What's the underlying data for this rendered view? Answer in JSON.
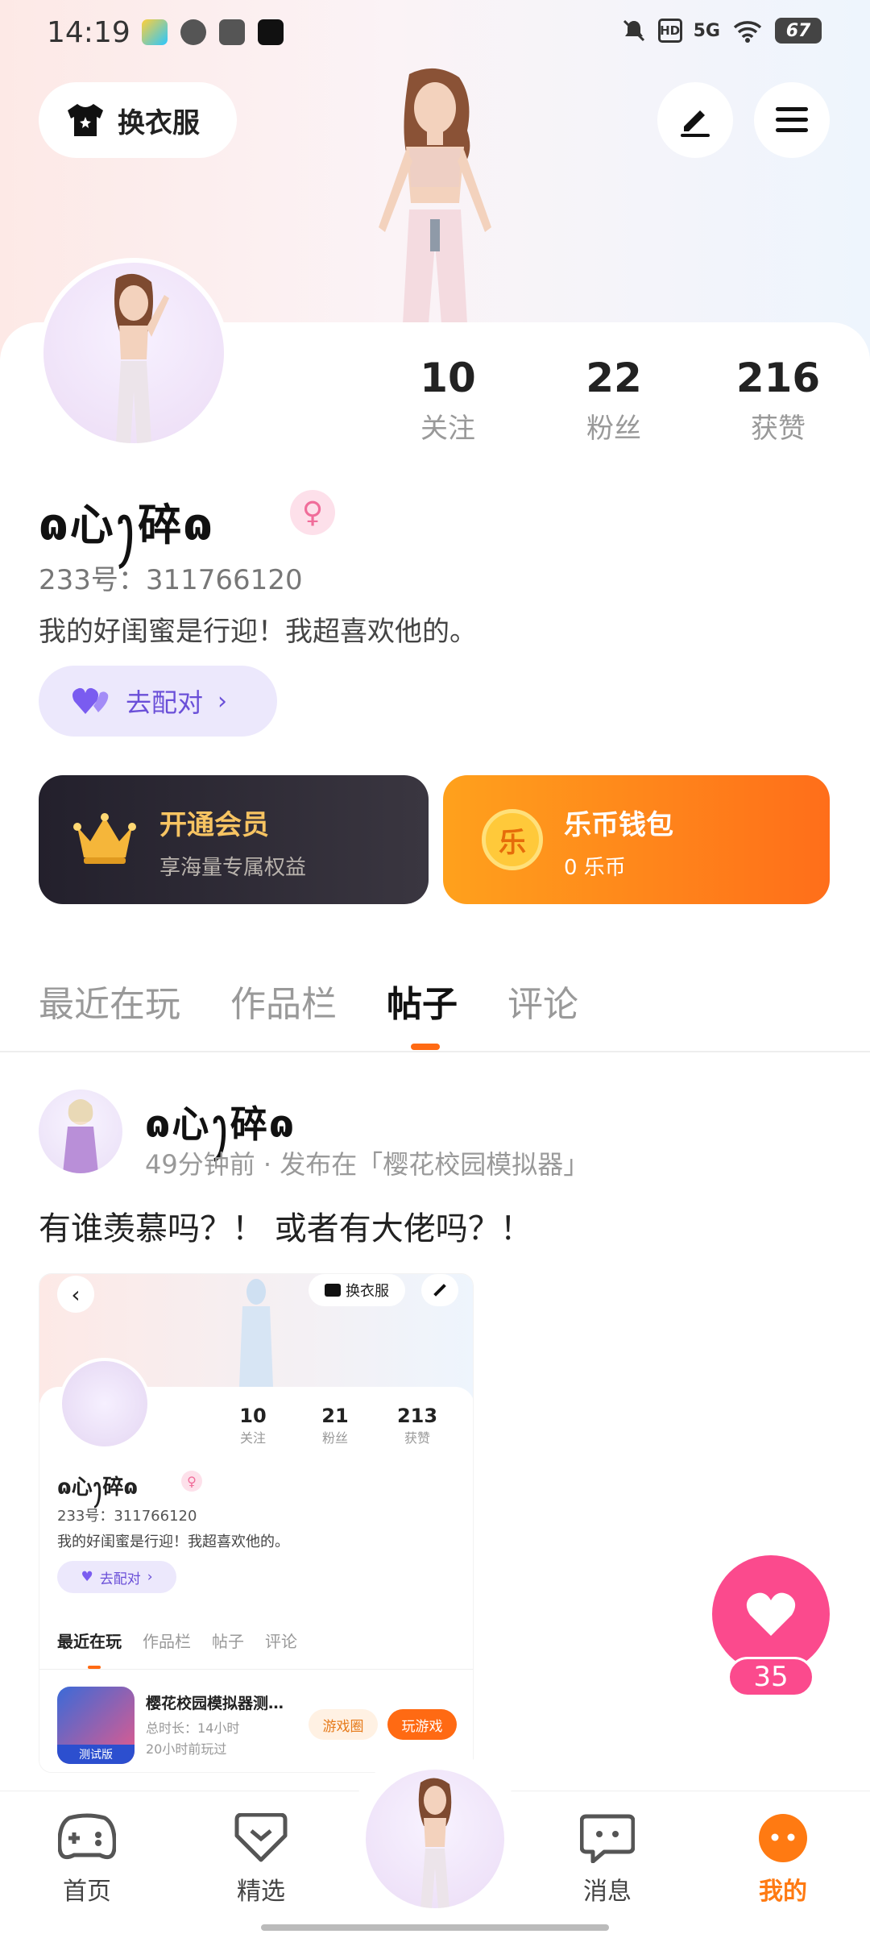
{
  "status_bar": {
    "time": "14:19",
    "network": "5G",
    "hd": "HD",
    "battery": "67"
  },
  "header": {
    "outfit_button": "换衣服"
  },
  "profile": {
    "stats": [
      {
        "value": "10",
        "label": "关注"
      },
      {
        "value": "22",
        "label": "粉丝"
      },
      {
        "value": "216",
        "label": "获赞"
      }
    ],
    "username": "ɷ心ꫂ碎ɷ",
    "id_label": "233号：311766120",
    "bio": "我的好闺蜜是行迎！我超喜欢他的。",
    "match_button": "去配对"
  },
  "vip_card": {
    "title": "开通会员",
    "subtitle": "享海量专属权益"
  },
  "wallet_card": {
    "title": "乐币钱包",
    "subtitle": "0 乐币",
    "coin_glyph": "乐"
  },
  "tabs": [
    {
      "label": "最近在玩"
    },
    {
      "label": "作品栏"
    },
    {
      "label": "帖子"
    },
    {
      "label": "评论"
    }
  ],
  "active_tab": "帖子",
  "post": {
    "author": "ɷ心ꫂ碎ɷ",
    "meta": "49分钟前 · 发布在「樱花校园模拟器」",
    "text": "有谁羡慕吗？！ 或者有大佬吗？！",
    "screenshot": {
      "outfit_button": "换衣服",
      "stats": [
        {
          "value": "10",
          "label": "关注"
        },
        {
          "value": "21",
          "label": "粉丝"
        },
        {
          "value": "213",
          "label": "获赞"
        }
      ],
      "username": "ɷ心ꫂ碎ɷ",
      "id_label": "233号：311766120",
      "bio": "我的好闺蜜是行迎！我超喜欢他的。",
      "match_button": "去配对",
      "tabs": [
        "最近在玩",
        "作品栏",
        "帖子",
        "评论"
      ],
      "game": {
        "title": "樱花校园模拟器测…",
        "duration": "总时长：14小时",
        "last_played": "20小时前玩过",
        "badge": "测试版",
        "btn_circle": "游戏圈",
        "btn_play": "玩游戏"
      }
    }
  },
  "like_count": "35",
  "bottom_nav": [
    {
      "label": "首页"
    },
    {
      "label": "精选"
    },
    {
      "label": "消息"
    },
    {
      "label": "我的"
    }
  ],
  "colors": {
    "accent": "#ff6a13",
    "like": "#fb4a8d",
    "match": "#6a4fd8"
  }
}
